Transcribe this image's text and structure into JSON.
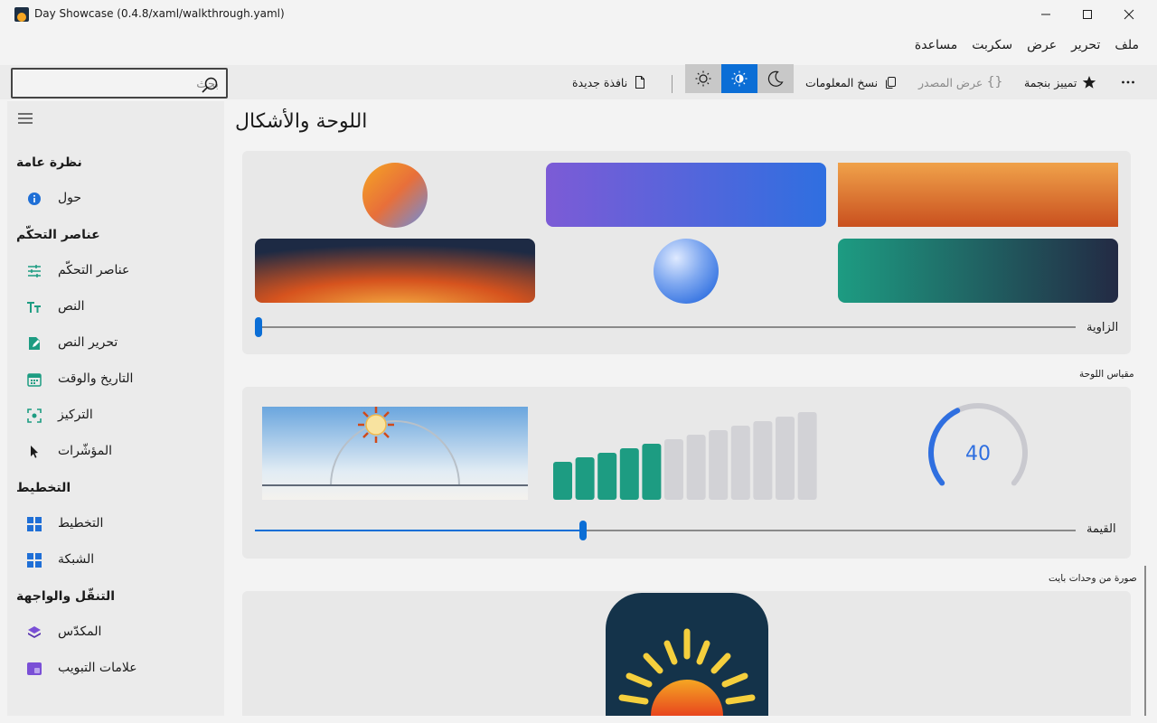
{
  "window": {
    "title": "Day Showcase (0.4.8/xaml/walkthrough.yaml)"
  },
  "menu": [
    "ملف",
    "تحرير",
    "عرض",
    "سكربت",
    "مساعدة"
  ],
  "search": {
    "placeholder": "بحث"
  },
  "toolbar": {
    "new_window": "نافذة جديدة",
    "copy_info": "نسخ المعلومات",
    "view_source": "عرض المصدر",
    "star_label": "تمييز بنجمة",
    "theme_active": "auto"
  },
  "sidebar": {
    "groups": [
      {
        "title": "نظرة عامة",
        "items": [
          {
            "label": "حول",
            "icon": "info-icon"
          }
        ]
      },
      {
        "title": "عناصر التحكّم",
        "items": [
          {
            "label": "عناصر التحكّم",
            "icon": "sliders-icon"
          },
          {
            "label": "النص",
            "icon": "text-icon"
          },
          {
            "label": "تحرير النص",
            "icon": "edit-icon"
          },
          {
            "label": "التاريخ والوقت",
            "icon": "calendar-icon"
          },
          {
            "label": "التركيز",
            "icon": "focus-icon"
          },
          {
            "label": "المؤشّرات",
            "icon": "pointer-icon"
          }
        ]
      },
      {
        "title": "التخطيط",
        "items": [
          {
            "label": "التخطيط",
            "icon": "layout-icon"
          },
          {
            "label": "الشبكة",
            "icon": "grid-icon"
          }
        ]
      },
      {
        "title": "التنقّل والواجهة",
        "items": [
          {
            "label": "المكدّس",
            "icon": "stack-icon"
          },
          {
            "label": "علامات التبويب",
            "icon": "tabs-icon"
          }
        ]
      }
    ]
  },
  "main": {
    "title": "اللوحة والأشكال",
    "angle_label": "الزاوية",
    "angle_value": 0,
    "gauge_section": "مقياس اللوحة",
    "value_label": "القيمة",
    "value": 40,
    "value_min": 0,
    "value_max": 100,
    "bytes_section": "صورة من وحدات بايت"
  },
  "colors": {
    "accent": "#0b6ed6",
    "teal": "#1d9c82",
    "navy": "#14334a"
  }
}
